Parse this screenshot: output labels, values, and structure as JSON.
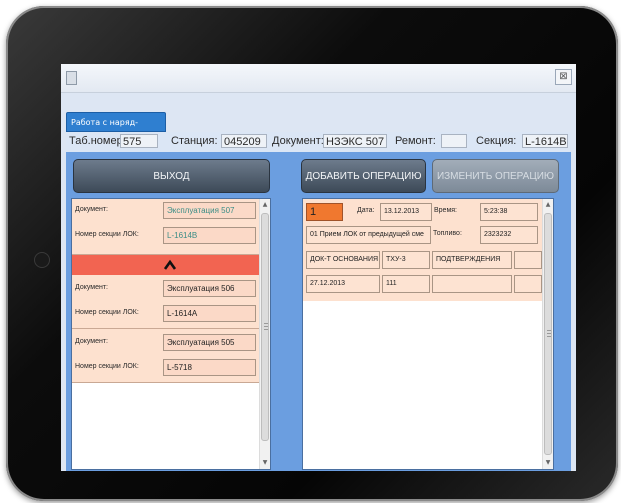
{
  "window": {
    "close_glyph": "⊠",
    "tab_label": "Работа с наряд-заказами"
  },
  "infobar": {
    "tab_number_label": "Таб.номер:",
    "tab_number_value": "575",
    "station_label": "Станция:",
    "station_value": "045209",
    "document_label": "Документ:",
    "document_value": "НЗЭКС 507",
    "repair_label": "Ремонт:",
    "repair_value": "",
    "section_label": "Секция:",
    "section_value": "L-1614B"
  },
  "buttons": {
    "exit": "ВЫХОД",
    "add_operation": "ДОБАВИТЬ ОПЕРАЦИЮ",
    "edit_operation": "ИЗМЕНИТЬ ОПЕРАЦИЮ"
  },
  "left_list": {
    "items": [
      {
        "doc_label": "Документ:",
        "doc_value": "Эксплуатация 507",
        "sec_label": "Номер секции ЛОК:",
        "sec_value": "L-1614B"
      },
      {
        "doc_label": "Документ:",
        "doc_value": "Эксплуатация 506",
        "sec_label": "Номер секции ЛОК:",
        "sec_value": "L-1614A"
      },
      {
        "doc_label": "Документ:",
        "doc_value": "Эксплуатация 505",
        "sec_label": "Номер секции ЛОК:",
        "sec_value": "L-5718"
      }
    ]
  },
  "right_panel": {
    "number": "1",
    "date_label": "Дата:",
    "date_value": "13.12.2013",
    "time_label": "Время:",
    "time_value": "5:23:38",
    "operation_text": "01 Прием ЛОК от предыдущей сме",
    "fuel_label": "Топливо:",
    "fuel_value": "2323232",
    "headers": [
      "ДОК-Т ОСНОВАНИЯ",
      "ТХУ-3",
      "ПОДТВЕРЖДЕНИЯ",
      ""
    ],
    "row": [
      "27.12.2013",
      "111",
      "",
      ""
    ]
  },
  "colors": {
    "accent": "#2f7fd0",
    "card": "#fde1cf",
    "red_bar": "#f26451",
    "number_cell": "#f0782f",
    "panel_bg": "#6b9ee0"
  },
  "icons": [
    "window-app-icon",
    "close-icon",
    "collapse-caret-icon",
    "scroll-up-icon",
    "scroll-down-icon"
  ]
}
